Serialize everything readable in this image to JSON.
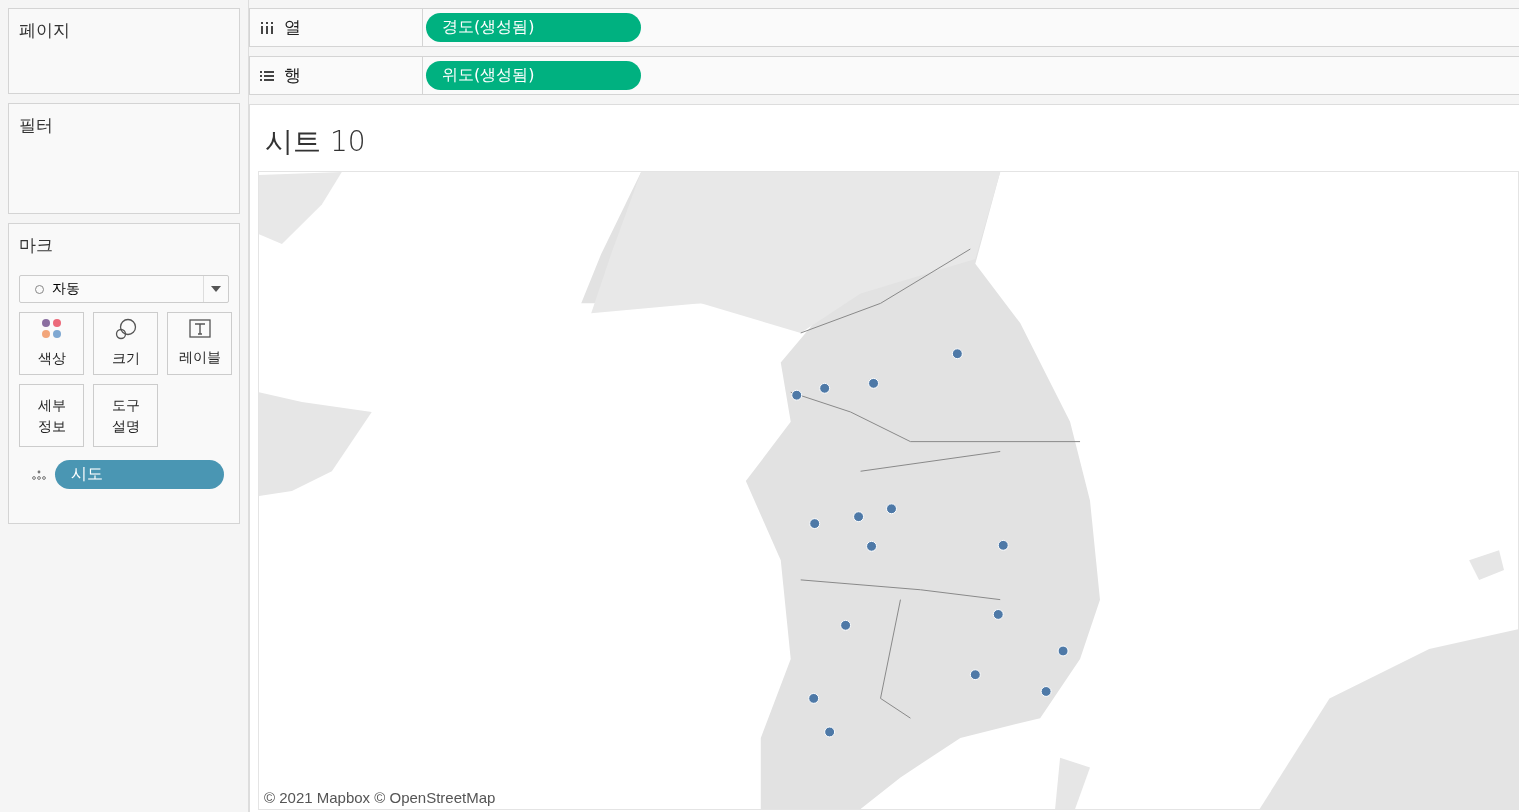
{
  "side": {
    "pages": {
      "title": "페이지"
    },
    "filters": {
      "title": "필터"
    },
    "marks": {
      "title": "마크",
      "mark_type": "자동",
      "cards": [
        {
          "kind": "color",
          "label": "색상"
        },
        {
          "kind": "size",
          "label": "크기"
        },
        {
          "kind": "label",
          "label": "레이블"
        },
        {
          "kind": "detail",
          "label": "세부\n정보"
        },
        {
          "kind": "tooltip",
          "label": "도구\n설명"
        }
      ],
      "pills": [
        {
          "kind": "detail",
          "label": "시도"
        }
      ]
    }
  },
  "shelves": [
    {
      "kind": "columns",
      "label": "열",
      "pill": "경도(생성됨)"
    },
    {
      "kind": "rows",
      "label": "행",
      "pill": "위도(생성됨)"
    }
  ],
  "sheet": {
    "title": "시트 10",
    "map": {
      "kind": "picture",
      "attribution": "© 2021 Mapbox © OpenStreetMap"
    }
  }
}
